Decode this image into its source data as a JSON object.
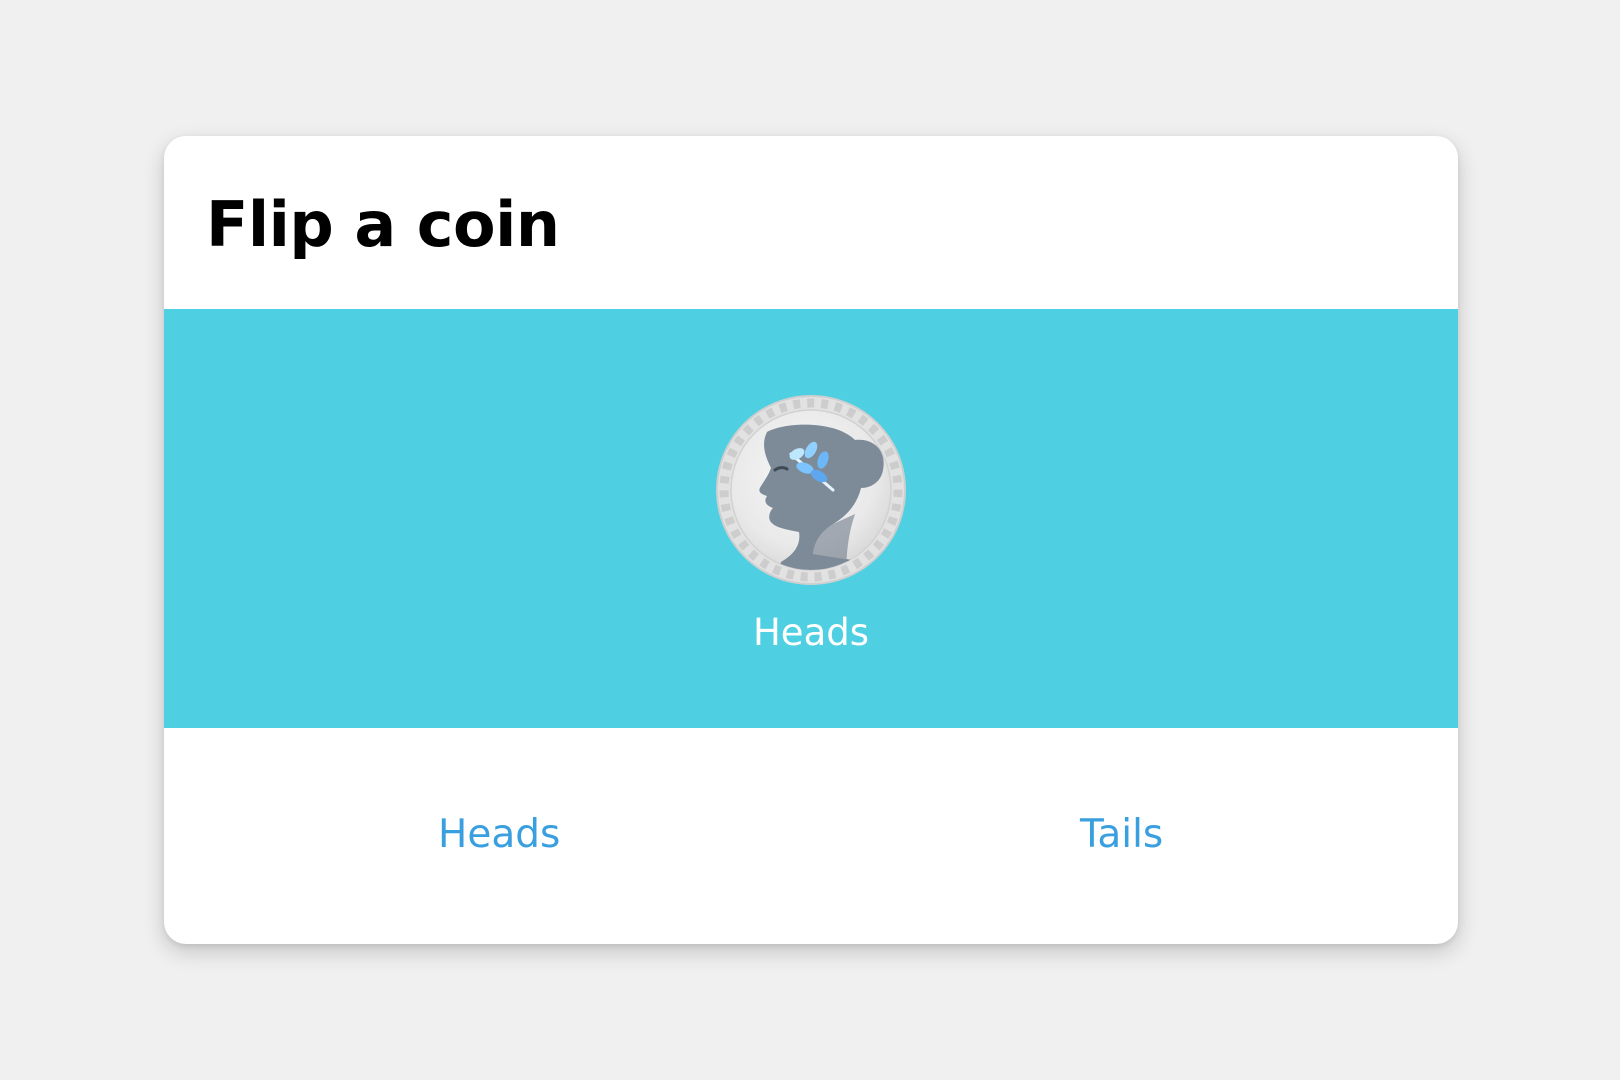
{
  "header": {
    "title": "Flip a coin"
  },
  "result": {
    "label": "Heads",
    "coin_icon": "coin-heads-icon",
    "panel_color": "#4ecfe2"
  },
  "actions": {
    "heads_label": "Heads",
    "tails_label": "Tails",
    "link_color": "#3a9fdf"
  }
}
